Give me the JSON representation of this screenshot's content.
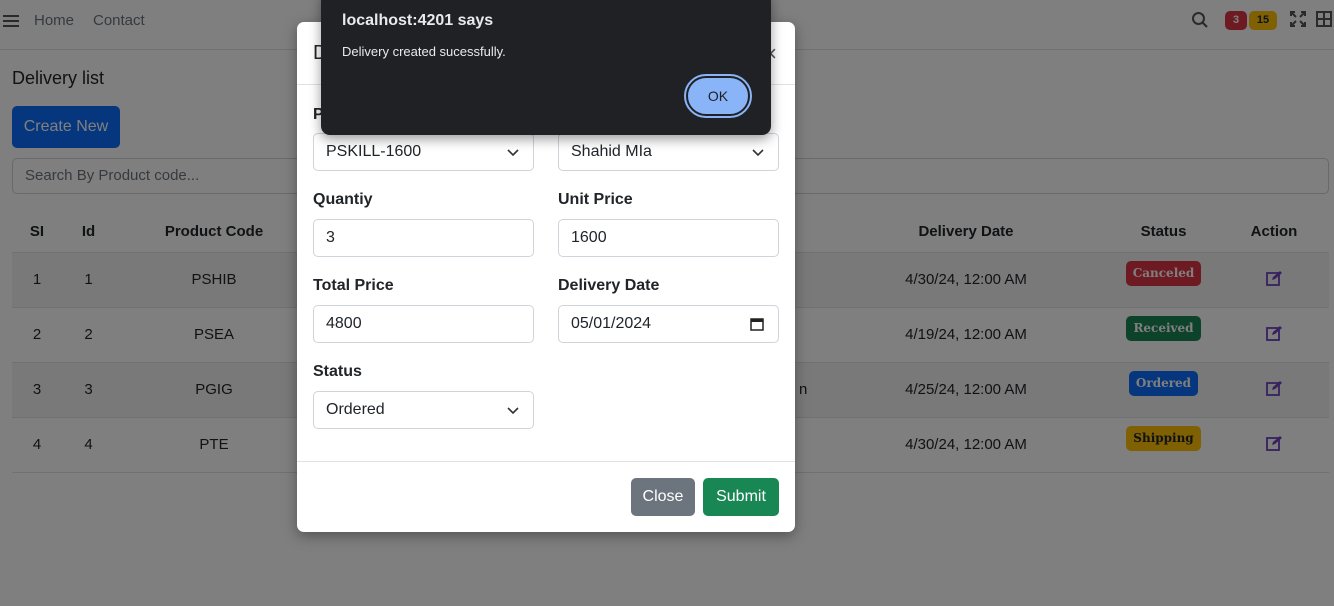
{
  "nav": {
    "home": "Home",
    "contact": "Contact",
    "badge_red": "3",
    "badge_yellow": "15"
  },
  "page": {
    "heading": "Delivery list",
    "create_button": "Create New",
    "search_placeholder": "Search By Product code..."
  },
  "table": {
    "headers": [
      "SI",
      "Id",
      "Product Code",
      "",
      "Delivery Date",
      "Status",
      "Action"
    ],
    "rows": [
      {
        "si": "1",
        "id": "1",
        "code": "PSHIB",
        "extra": "",
        "date": "4/30/24, 12:00 AM",
        "status": "Canceled",
        "status_color": "#dc3545"
      },
      {
        "si": "2",
        "id": "2",
        "code": "PSEA",
        "extra": "",
        "date": "4/19/24, 12:00 AM",
        "status": "Received",
        "status_color": "#198754"
      },
      {
        "si": "3",
        "id": "3",
        "code": "PGIG",
        "extra": "n",
        "date": "4/25/24, 12:00 AM",
        "status": "Ordered",
        "status_color": "#0d6efd"
      },
      {
        "si": "4",
        "id": "4",
        "code": "PTE",
        "extra": "",
        "date": "4/30/24, 12:00 AM",
        "status": "Shipping",
        "status_color": "#ffc107"
      }
    ]
  },
  "modal": {
    "title_partial": "D",
    "close_symbol": "×",
    "first_label_partial": "P",
    "product_value": "PSKILL-1600",
    "customer_value": "Shahid MIa",
    "quantity_label": "Quantiy",
    "quantity_value": "3",
    "unit_price_label": "Unit Price",
    "unit_price_value": "1600",
    "total_price_label": "Total Price",
    "total_price_value": "4800",
    "delivery_date_label": "Delivery Date",
    "delivery_date_value": "05/01/2024",
    "status_label": "Status",
    "status_value": "Ordered",
    "close_button": "Close",
    "submit_button": "Submit"
  },
  "alert": {
    "title": "localhost:4201 says",
    "message": "Delivery created sucessfully.",
    "ok_button": "OK"
  },
  "colors": {
    "primary": "#0d6efd",
    "success": "#198754",
    "secondary": "#6c757d",
    "alert_bg": "#202124",
    "alert_accent": "#8ab4f8"
  }
}
